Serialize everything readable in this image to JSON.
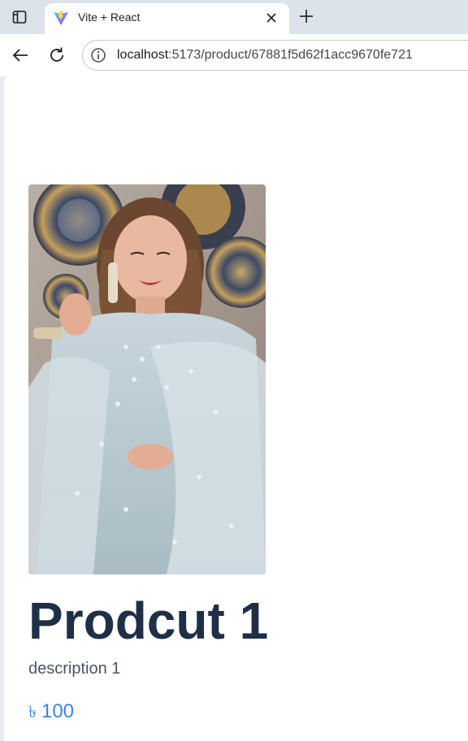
{
  "browser": {
    "tab": {
      "title": "Vite + React",
      "favicon": "vite-logo-icon"
    },
    "address_bar": {
      "host": "localhost",
      "path": ":5173/product/67881f5d62f1acc9670fe721"
    },
    "icons": {
      "tab_grid": "tab-grid-icon",
      "close": "close-icon",
      "new_tab": "plus-icon",
      "back": "back-arrow-icon",
      "reload": "reload-icon",
      "site_info": "info-icon"
    }
  },
  "product": {
    "image": "product-photo",
    "title": "Prodcut 1",
    "description": "description 1",
    "currency": "৳",
    "price": "100"
  },
  "colors": {
    "title": "#1e2f47",
    "description": "#4b5563",
    "price": "#3b82f6",
    "tabbar": "#dde3ea"
  }
}
